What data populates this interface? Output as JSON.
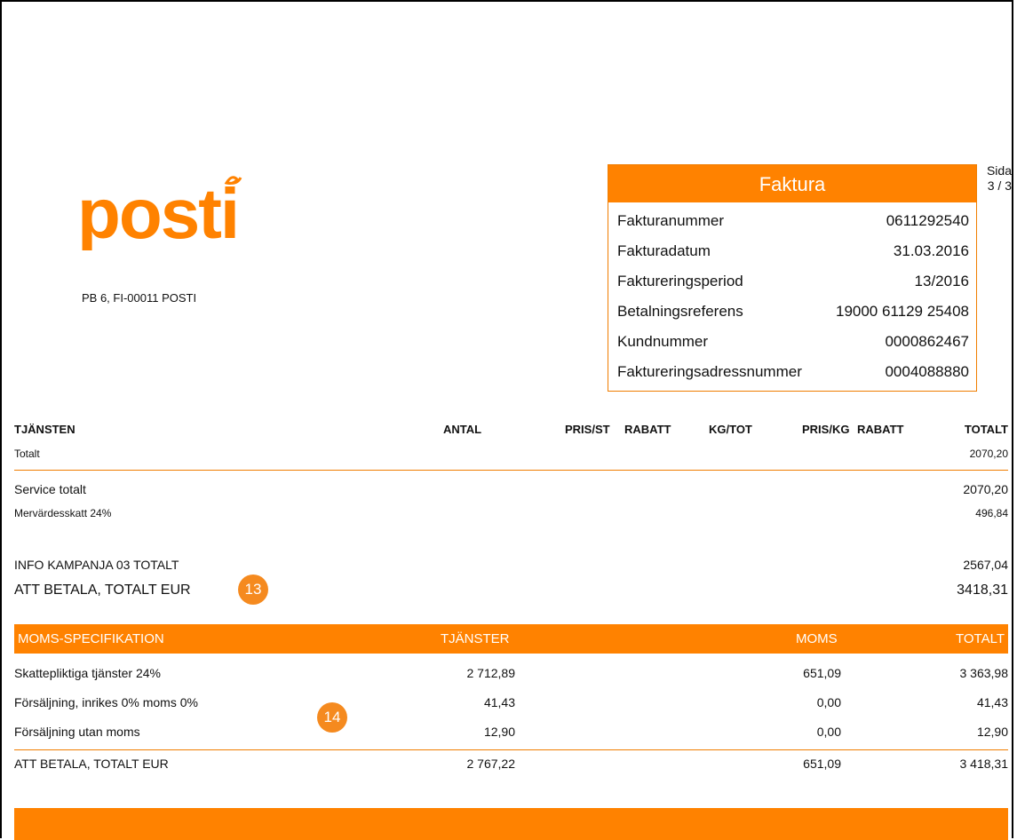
{
  "logo": {
    "text": "posti"
  },
  "address": "PB 6, FI-00011 POSTI",
  "page_indicator": {
    "label": "Sida",
    "value": "3 / 3"
  },
  "invoice": {
    "title": "Faktura",
    "rows": [
      {
        "label": "Fakturanummer",
        "value": "0611292540"
      },
      {
        "label": "Fakturadatum",
        "value": "31.03.2016"
      },
      {
        "label": "Faktureringsperiod",
        "value": "13/2016"
      },
      {
        "label": "Betalningsreferens",
        "value": "19000 61129 25408"
      },
      {
        "label": "Kundnummer",
        "value": "0000862467"
      },
      {
        "label": "Faktureringsadressnummer",
        "value": "0004088880"
      }
    ]
  },
  "services_table": {
    "headers": [
      "TJÄNSTEN",
      "ANTAL",
      "PRIS/ST",
      "RABATT",
      "KG/TOT",
      "PRIS/KG",
      "RABATT",
      "TOTALT"
    ],
    "total_row": {
      "label": "Totalt",
      "value": "2070,20"
    }
  },
  "summary": {
    "service_total": {
      "label": "Service totalt",
      "value": "2070,20"
    },
    "vat": {
      "label": "Mervärdesskatt 24%",
      "value": "496,84"
    },
    "info_total": {
      "label": "INFO KAMPANJA 03 TOTALT",
      "value": "2567,04"
    },
    "to_pay": {
      "label": "ATT BETALA, TOTALT EUR",
      "value": "3418,31"
    }
  },
  "badges": {
    "first": "13",
    "second": "14"
  },
  "vat_spec": {
    "headers": [
      "MOMS-SPECIFIKATION",
      "TJÄNSTER",
      "MOMS",
      "TOTALT"
    ],
    "rows": [
      {
        "label": "Skattepliktiga tjänster 24%",
        "services": "2 712,89",
        "vat": "651,09",
        "total": "3 363,98"
      },
      {
        "label": "Försäljning, inrikes 0% moms 0%",
        "services": "41,43",
        "vat": "0,00",
        "total": "41,43"
      },
      {
        "label": "Försäljning utan moms",
        "services": "12,90",
        "vat": "0,00",
        "total": "12,90"
      }
    ],
    "total_row": {
      "label": "ATT BETALA, TOTALT EUR",
      "services": "2 767,22",
      "vat": "651,09",
      "total": "3 418,31"
    }
  },
  "colors": {
    "accent": "#ff8200"
  }
}
